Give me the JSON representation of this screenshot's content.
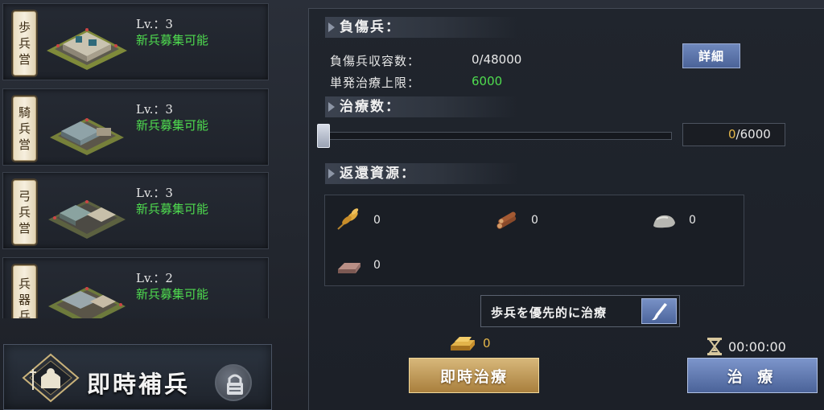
{
  "buildings": [
    {
      "plate": [
        "歩",
        "兵",
        "営"
      ],
      "level": "Lv.：3",
      "status": "新兵募集可能"
    },
    {
      "plate": [
        "騎",
        "兵",
        "営"
      ],
      "level": "Lv.：3",
      "status": "新兵募集可能"
    },
    {
      "plate": [
        "弓",
        "兵",
        "営"
      ],
      "level": "Lv.：3",
      "status": "新兵募集可能"
    },
    {
      "plate": [
        "兵",
        "器",
        "兵"
      ],
      "level": "Lv.：2",
      "status": "新兵募集可能"
    }
  ],
  "reinforce": {
    "label": "即時補兵",
    "icon": "lock-icon"
  },
  "wounded": {
    "title": "負傷兵：",
    "capacity_label": "負傷兵収容数：",
    "capacity_value": "0/48000",
    "limit_label": "単発治療上限：",
    "limit_value": "6000",
    "detail_button": "詳細"
  },
  "heal_count": {
    "title": "治療数：",
    "current": "0",
    "max": "/6000",
    "slider_fraction": 0
  },
  "return_resources": {
    "title": "返還資源：",
    "items": [
      {
        "icon": "grain-icon",
        "value": "0"
      },
      {
        "icon": "wood-icon",
        "value": "0"
      },
      {
        "icon": "stone-icon",
        "value": "0"
      },
      {
        "icon": "iron-icon",
        "value": "0"
      }
    ]
  },
  "priority_button": "歩兵を優先的に治療",
  "gold_cost": "0",
  "timer": "00:00:00",
  "instant_heal_button": "即時治療",
  "heal_button": "治 療",
  "colors": {
    "accent_green": "#4fdc4f",
    "gold": "#e6b84a",
    "button_blue": "#5a73aa",
    "button_gold": "#c09a57"
  }
}
